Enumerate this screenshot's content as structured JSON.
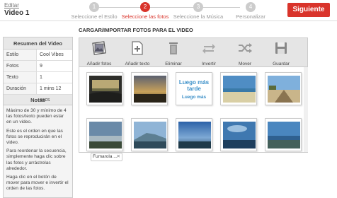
{
  "header": {
    "edit_label": "Editar",
    "video_title": "Video 1",
    "next_label": "Siguiente",
    "steps": [
      {
        "num": "1",
        "label": "Seleccione el Estilo",
        "active": false
      },
      {
        "num": "2",
        "label": "Seleccione las fotos",
        "active": true
      },
      {
        "num": "3",
        "label": "Seleccione la Música",
        "active": false
      },
      {
        "num": "4",
        "label": "Personalizar",
        "active": false
      }
    ],
    "accent_color": "#d9342b"
  },
  "sidebar": {
    "title": "Resumen del Video",
    "rows": [
      {
        "key": "Estilo",
        "value": "Cool Vibes"
      },
      {
        "key": "Fotos",
        "value": "9"
      },
      {
        "key": "Texto",
        "value": "1"
      },
      {
        "key": "Duración",
        "value": "1 mins 12 secs"
      }
    ],
    "notes_title": "Notas",
    "notes": [
      "Máximo de 30 y mínimo de 4 las fotos/texto pueden estar en un video.",
      "Este es el orden en que las fotos se reproducirán en el video.",
      "Para reordenar la secuencia, simplemente haga clic sobre las fotos y arrástrelas alrededor.",
      "Haga clic en el botón de mover para mover e invertir el orden de las fotos."
    ]
  },
  "main": {
    "title": "CARGAR/IMPORTAR FOTOS PARA EL VIDEO",
    "toolbar": [
      {
        "label": "Añadir fotos",
        "icon": "add-photos-icon"
      },
      {
        "label": "Añadir texto",
        "icon": "add-text-icon"
      },
      {
        "label": "Eliminar",
        "icon": "trash-icon"
      },
      {
        "label": "Invertir",
        "icon": "invert-arrows-icon"
      },
      {
        "label": "Mover",
        "icon": "shuffle-icon"
      },
      {
        "label": "Guardar",
        "icon": "save-disk-icon"
      }
    ],
    "text_card": {
      "line1": "Luego más tarde",
      "line2": "Luego más"
    },
    "caption_chip": "Fumarola ..."
  }
}
